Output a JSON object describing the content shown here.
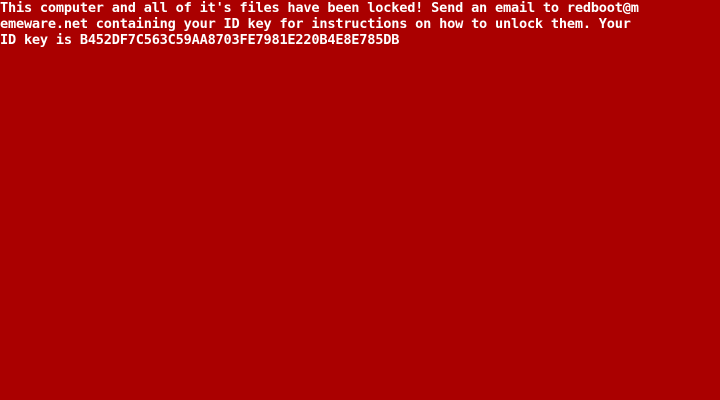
{
  "screen": {
    "background_color": "#aa0000",
    "text_color": "#ffffff",
    "message_lines": [
      "This computer and all of it's files have been locked! Send an email to redboot@m",
      "emeware.net containing your ID key for instructions on how to unlock them. Your",
      "ID key is B452DF7C563C59AA8703FE7981E220B4E8E785DB"
    ]
  }
}
